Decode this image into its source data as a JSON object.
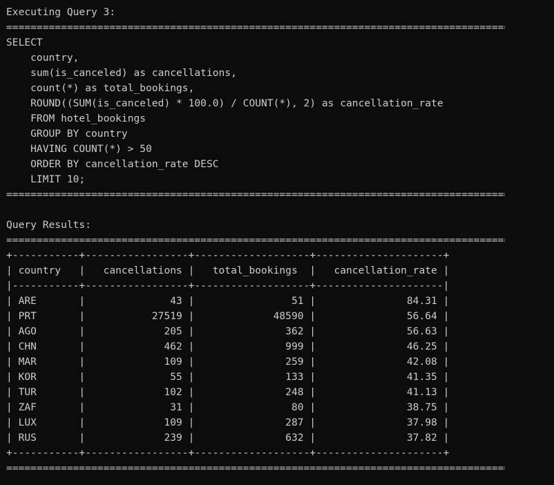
{
  "header": "Executing Query 3:",
  "separator": "==========================================================================================",
  "sql": [
    "SELECT",
    "    country,",
    "    sum(is_canceled) as cancellations,",
    "    count(*) as total_bookings,",
    "    ROUND((SUM(is_canceled) * 100.0) / COUNT(*), 2) as cancellation_rate",
    "    FROM hotel_bookings",
    "    GROUP BY country",
    "    HAVING COUNT(*) > 50",
    "    ORDER BY cancellation_rate DESC",
    "    LIMIT 10;"
  ],
  "results_label": "Query Results:",
  "table": {
    "border": "+-----------+-----------------+-------------------+---------------------+",
    "header_divider": "|-----------+-----------------+-------------------+---------------------|",
    "header_row": "| country   |   cancellations |   total_bookings  |   cancellation_rate |",
    "columns": [
      "country",
      "cancellations",
      "total_bookings",
      "cancellation_rate"
    ],
    "rows": [
      "| ARE       |              43 |                51 |               84.31 |",
      "| PRT       |           27519 |             48590 |               56.64 |",
      "| AGO       |             205 |               362 |               56.63 |",
      "| CHN       |             462 |               999 |               46.25 |",
      "| MAR       |             109 |               259 |               42.08 |",
      "| KOR       |              55 |               133 |               41.35 |",
      "| TUR       |             102 |               248 |               41.13 |",
      "| ZAF       |              31 |                80 |               38.75 |",
      "| LUX       |             109 |               287 |               37.98 |",
      "| RUS       |             239 |               632 |               37.82 |"
    ]
  }
}
